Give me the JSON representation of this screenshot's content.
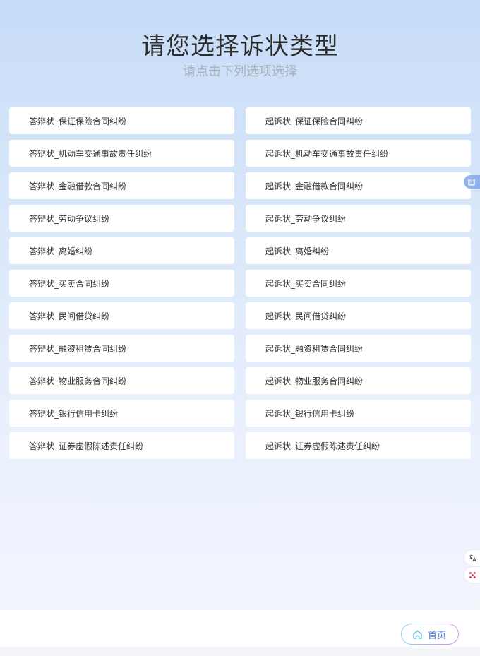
{
  "header": {
    "title": "请您选择诉状类型",
    "subtitle": "请点击下列选项选择"
  },
  "options": [
    "答辩状_保证保险合同纠纷",
    "起诉状_保证保险合同纠纷",
    "答辩状_机动车交通事故责任纠纷",
    "起诉状_机动车交通事故责任纠纷",
    "答辩状_金融借款合同纠纷",
    "起诉状_金融借款合同纠纷",
    "答辩状_劳动争议纠纷",
    "起诉状_劳动争议纠纷",
    "答辩状_离婚纠纷",
    "起诉状_离婚纠纷",
    "答辩状_买卖合同纠纷",
    "起诉状_买卖合同纠纷",
    "答辩状_民间借贷纠纷",
    "起诉状_民间借贷纠纷",
    "答辩状_融资租赁合同纠纷",
    "起诉状_融资租赁合同纠纷",
    "答辩状_物业服务合同纠纷",
    "起诉状_物业服务合同纠纷",
    "答辩状_银行信用卡纠纷",
    "起诉状_银行信用卡纠纷",
    "答辩状_证券虚假陈述责任纠纷",
    "起诉状_证券虚假陈述责任纠纷"
  ],
  "side_tab": {
    "label": "译",
    "icon": "translate-icon"
  },
  "floating_tools": [
    {
      "icon": "translate-tool-icon"
    },
    {
      "icon": "apps-dots-icon"
    }
  ],
  "footer": {
    "home_label": "首页",
    "home_icon": "home-icon"
  },
  "colors": {
    "accent": "#4f7fd6",
    "background_top": "#c6dcf7",
    "background_bottom": "#f2f5fe"
  }
}
